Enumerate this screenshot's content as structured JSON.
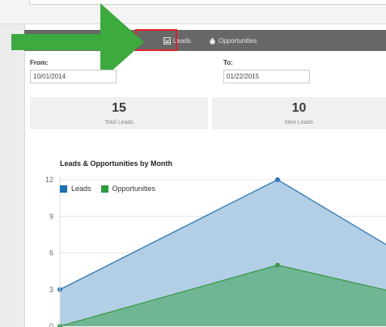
{
  "nav": {
    "leads_label": "Leads",
    "opportunities_label": "Opportunities",
    "leads_icon": "inbox-icon",
    "opportunities_icon": "money-bag-icon"
  },
  "filters": {
    "from_label": "From:",
    "from_value": "10/01/2014",
    "to_label": "To:",
    "to_value": "01/22/2015"
  },
  "stats": [
    {
      "value": "15",
      "label": "Total Leads"
    },
    {
      "value": "10",
      "label": "New Leads"
    }
  ],
  "colors": {
    "leads_line": "#2f78b5",
    "leads_fill": "#b3cfe6",
    "opportunities_line": "#3a9a4a",
    "opportunities_fill": "#6db48f",
    "arrow": "#3daa3f",
    "highlight": "#e0202a"
  },
  "chart_data": {
    "type": "area",
    "title": "Leads & Opportunities by Month",
    "xlabel": "",
    "ylabel": "",
    "ylim": [
      0,
      12
    ],
    "y_ticks": [
      "0",
      "3",
      "6",
      "9",
      "12"
    ],
    "grid": true,
    "legend": "top-left",
    "series": [
      {
        "name": "Leads",
        "values": [
          3,
          12,
          5.5
        ]
      },
      {
        "name": "Opportunities",
        "values": [
          0,
          5,
          2.5
        ]
      }
    ]
  }
}
